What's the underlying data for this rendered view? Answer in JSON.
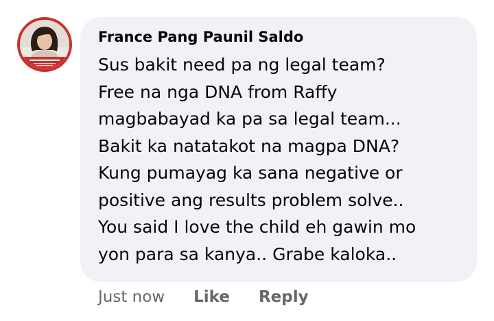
{
  "comment": {
    "avatar_icon": "profile-photo",
    "accent_color": "#c9302c",
    "author": "France Pang Paunil Saldo",
    "lines": [
      "Sus bakit need pa ng legal team?",
      "Free na nga DNA from Raffy",
      "magbabayad ka pa sa legal team...",
      "Bakit ka natatakot na magpa DNA?",
      "Kung pumayag ka sana negative or",
      "positive ang results problem solve..",
      "You said I love the child eh gawin mo",
      "yon para sa kanya.. Grabe kaloka.."
    ]
  },
  "actions": {
    "timestamp": "Just now",
    "like_label": "Like",
    "reply_label": "Reply"
  }
}
